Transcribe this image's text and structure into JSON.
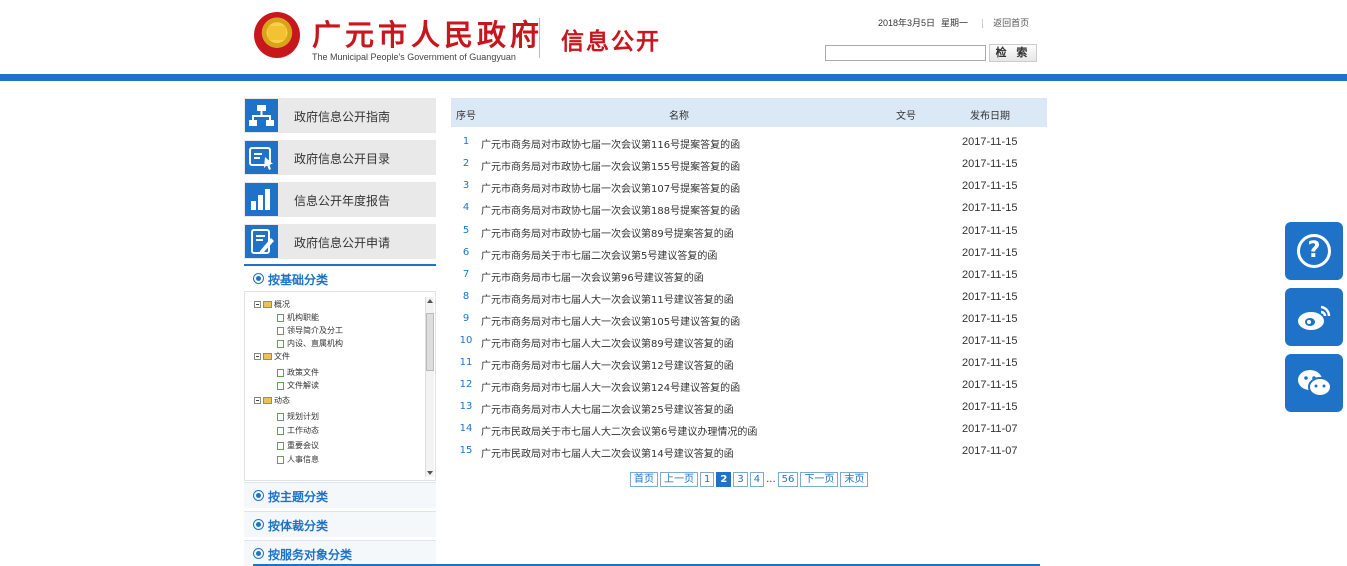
{
  "header": {
    "site_title": "广元市人民政府",
    "site_subtitle": "The Municipal People's Government of Guangyuan",
    "section_title": "信息公开",
    "date": "2018年3月5日",
    "weekday": "星期一",
    "home_link": "返回首页",
    "search": {
      "value": "",
      "placeholder": "",
      "button_label": "检 索"
    }
  },
  "sidebar": {
    "nav": [
      {
        "label": "政府信息公开指南",
        "icon": "org-chart-icon"
      },
      {
        "label": "政府信息公开目录",
        "icon": "catalog-icon"
      },
      {
        "label": "信息公开年度报告",
        "icon": "bar-chart-icon"
      },
      {
        "label": "政府信息公开申请",
        "icon": "application-form-icon"
      }
    ],
    "categories": [
      {
        "label": "按基础分类"
      },
      {
        "label": "按主题分类"
      },
      {
        "label": "按体裁分类"
      },
      {
        "label": "按服务对象分类"
      }
    ],
    "tree": [
      {
        "label": "概况",
        "type": "folder"
      },
      {
        "label": "机构职能",
        "type": "doc"
      },
      {
        "label": "领导简介及分工",
        "type": "doc"
      },
      {
        "label": "内设、直属机构",
        "type": "doc"
      },
      {
        "label": "文件",
        "type": "folder"
      },
      {
        "label": "政策文件",
        "type": "doc"
      },
      {
        "label": "文件解读",
        "type": "doc"
      },
      {
        "label": "动态",
        "type": "folder"
      },
      {
        "label": "规划计划",
        "type": "doc"
      },
      {
        "label": "工作动态",
        "type": "doc"
      },
      {
        "label": "重要会议",
        "type": "doc"
      },
      {
        "label": "人事信息",
        "type": "doc"
      }
    ]
  },
  "table": {
    "headers": {
      "index": "序号",
      "name": "名称",
      "doc_no": "文号",
      "date": "发布日期"
    },
    "rows": [
      {
        "index": "1",
        "name": "广元市商务局对市政协七届一次会议第116号提案答复的函",
        "date": "2017-11-15"
      },
      {
        "index": "2",
        "name": "广元市商务局对市政协七届一次会议第155号提案答复的函",
        "date": "2017-11-15"
      },
      {
        "index": "3",
        "name": "广元市商务局对市政协七届一次会议第107号提案答复的函",
        "date": "2017-11-15"
      },
      {
        "index": "4",
        "name": "广元市商务局对市政协七届一次会议第188号提案答复的函",
        "date": "2017-11-15"
      },
      {
        "index": "5",
        "name": "广元市商务局对市政协七届一次会议第89号提案答复的函",
        "date": "2017-11-15"
      },
      {
        "index": "6",
        "name": "广元市商务局关于市七届二次会议第5号建议答复的函",
        "date": "2017-11-15"
      },
      {
        "index": "7",
        "name": "广元市商务局市七届一次会议第96号建议答复的函",
        "date": "2017-11-15"
      },
      {
        "index": "8",
        "name": "广元市商务局对市七届人大一次会议第11号建议答复的函",
        "date": "2017-11-15"
      },
      {
        "index": "9",
        "name": "广元市商务局对市七届人大一次会议第105号建议答复的函",
        "date": "2017-11-15"
      },
      {
        "index": "10",
        "name": "广元市商务局对市七届人大二次会议第89号建议答复的函",
        "date": "2017-11-15"
      },
      {
        "index": "11",
        "name": "广元市商务局对市七届人大一次会议第12号建议答复的函",
        "date": "2017-11-15"
      },
      {
        "index": "12",
        "name": "广元市商务局对市七届人大一次会议第124号建议答复的函",
        "date": "2017-11-15"
      },
      {
        "index": "13",
        "name": "广元市商务局对市人大七届二次会议第25号建议答复的函",
        "date": "2017-11-15"
      },
      {
        "index": "14",
        "name": "广元市民政局关于市七届人大二次会议第6号建议办理情况的函",
        "date": "2017-11-07"
      },
      {
        "index": "15",
        "name": "广元市民政局对市七届人大二次会议第14号建议答复的函",
        "date": "2017-11-07"
      }
    ]
  },
  "pager": {
    "first": "首页",
    "prev": "上一页",
    "pages": [
      "1",
      "2",
      "3",
      "4"
    ],
    "current": "2",
    "ellipsis": "...",
    "last_page": "56",
    "next": "下一页",
    "last": "末页"
  },
  "float_buttons": [
    {
      "icon": "help-icon",
      "glyph": "?"
    },
    {
      "icon": "weibo-icon"
    },
    {
      "icon": "wechat-icon"
    }
  ],
  "colors": {
    "accent": "#1e73c8",
    "brand_red": "#c8161d",
    "table_header_bg": "#dbe8f5"
  }
}
